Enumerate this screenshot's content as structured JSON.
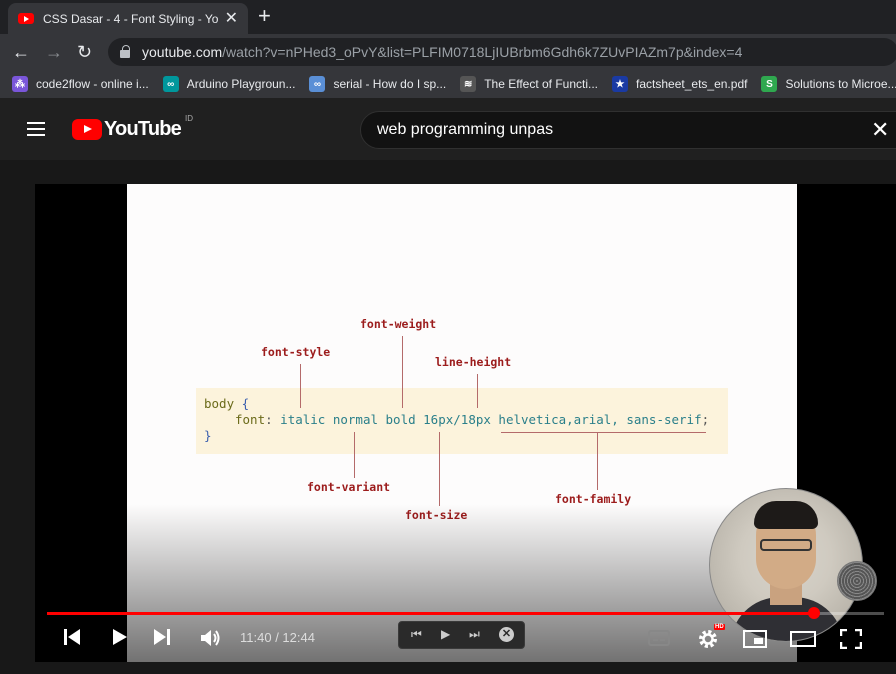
{
  "browser": {
    "tab_title": "CSS Dasar - 4 - Font Styling - You",
    "url_host": "youtube.com",
    "url_path": "/watch?v=nPHed3_oPvY&list=PLFIM0718LjIUBrbm6Gdh6k7ZUvPIAZm7p&index=4",
    "bookmarks": [
      {
        "label": "code2flow - online i...",
        "color": "#7a56d9",
        "glyph": "⁂"
      },
      {
        "label": "Arduino Playgroun...",
        "color": "#00979c",
        "glyph": "∞"
      },
      {
        "label": "serial - How do I sp...",
        "color": "#5a8fd6",
        "glyph": "∞"
      },
      {
        "label": "The Effect of Functi...",
        "color": "#555555",
        "glyph": "≋"
      },
      {
        "label": "factsheet_ets_en.pdf",
        "color": "#1a3aa3",
        "glyph": "★"
      },
      {
        "label": "Solutions to Microe...",
        "color": "#2fa84f",
        "glyph": "S"
      }
    ]
  },
  "youtube": {
    "logo_text": "YouTube",
    "country_code": "ID",
    "search_query": "web programming unpas"
  },
  "slide": {
    "code_line1_kw": "body",
    "code_line1_brace": "{",
    "code_line2_prop": "font",
    "code_line2_colon": ":",
    "code_line2_value": "italic normal bold 16px/18px helvetica,arial, sans-serif",
    "code_line2_semicolon": ";",
    "code_line3": "}",
    "labels": {
      "font_weight": "font-weight",
      "font_style": "font-style",
      "line_height": "line-height",
      "font_variant": "font-variant",
      "font_size": "font-size",
      "font_family": "font-family"
    }
  },
  "player": {
    "current_time": "11:40",
    "separator": " / ",
    "duration": "12:44",
    "progress_fraction": 0.916,
    "hd_badge": "HD"
  }
}
